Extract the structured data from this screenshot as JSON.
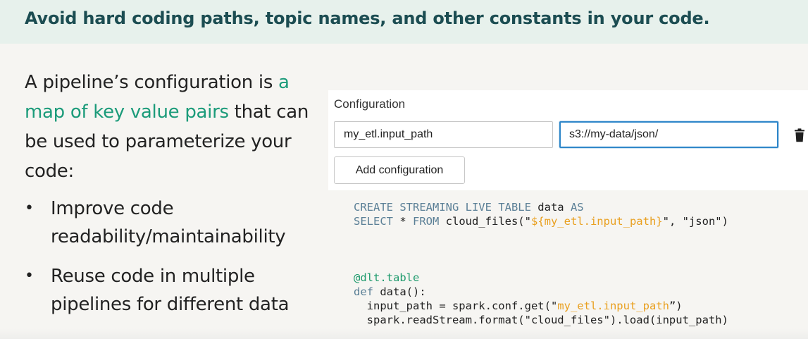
{
  "title": "Avoid hard coding paths, topic names, and other constants in your code.",
  "intro": {
    "before": "A pipeline’s configuration is ",
    "highlight": "a map of key value pairs",
    "after": " that can be used to parameterize your code:"
  },
  "bullets": [
    "Improve code readability/maintainability",
    "Reuse code in multiple pipelines for different data"
  ],
  "bullet_glyph": "•",
  "configuration": {
    "label": "Configuration",
    "key_value": "my_etl.input_path",
    "value_value": "s3://my-data/json/",
    "add_button_label": "Add configuration",
    "delete_icon": "trash-icon"
  },
  "sql_code": {
    "line1_kw": "CREATE STREAMING LIVE TABLE",
    "line1_name": " data ",
    "line1_as": "AS",
    "line2_kw1": "SELECT",
    "line2_star": " * ",
    "line2_kw2": "FROM",
    "line2_fn": " cloud_files(\"",
    "line2_var": "${my_etl.input_path}",
    "line2_tail": "\", \"json\")"
  },
  "py_code": {
    "decorator": "@dlt.table",
    "def_kw": "def",
    "def_tail": " data():",
    "line3_head": "  input_path = spark.conf.get(\"",
    "line3_var": "my_etl.input_path",
    "line3_tail": "”)",
    "line4": "  spark.readStream.format(\"cloud_files\").load(input_path)"
  },
  "colors": {
    "title": "#1c4d52",
    "accent": "#1b9b7a",
    "sql_keyword": "#5a7f96",
    "variable": "#e9a020",
    "decorator": "#1d9a6c",
    "focus_border": "#2e86c9"
  }
}
